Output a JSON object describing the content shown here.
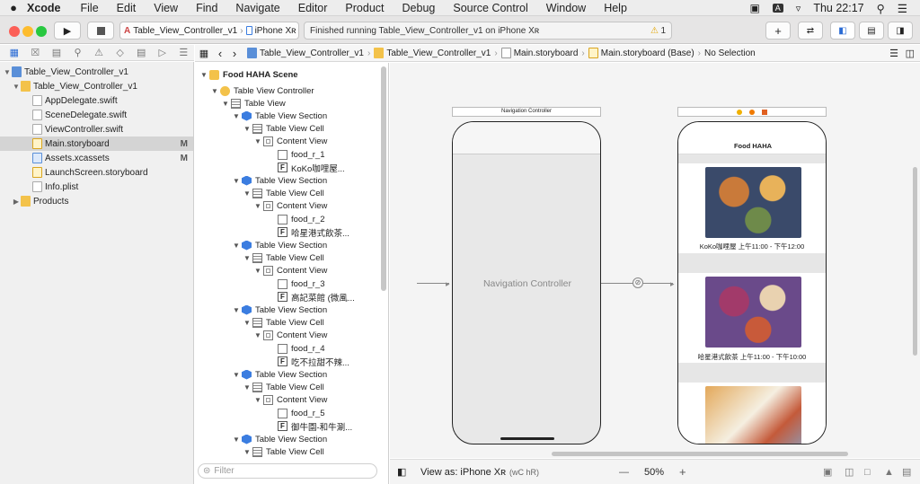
{
  "menubar": {
    "apple": "",
    "app": "Xcode",
    "items": [
      "File",
      "Edit",
      "View",
      "Find",
      "Navigate",
      "Editor",
      "Product",
      "Debug",
      "Source Control",
      "Window",
      "Help"
    ],
    "a_badge": "A",
    "clock": "Thu 22:17"
  },
  "toolbar": {
    "scheme": "Table_View_Controller_v1",
    "device": "iPhone Xʀ",
    "activity": "Finished running Table_View_Controller_v1 on iPhone Xʀ",
    "warning_count": "1"
  },
  "navigator": {
    "rows": [
      {
        "label": "Table_View_Controller_v1",
        "mark": ""
      },
      {
        "label": "Table_View_Controller_v1",
        "mark": ""
      },
      {
        "label": "AppDelegate.swift",
        "mark": ""
      },
      {
        "label": "SceneDelegate.swift",
        "mark": ""
      },
      {
        "label": "ViewController.swift",
        "mark": ""
      },
      {
        "label": "Main.storyboard",
        "mark": "M"
      },
      {
        "label": "Assets.xcassets",
        "mark": "M"
      },
      {
        "label": "LaunchScreen.storyboard",
        "mark": ""
      },
      {
        "label": "Info.plist",
        "mark": ""
      },
      {
        "label": "Products",
        "mark": ""
      }
    ]
  },
  "jumpbar": {
    "crumbs": [
      "Table_View_Controller_v1",
      "Table_View_Controller_v1",
      "Main.storyboard",
      "Main.storyboard (Base)",
      "No Selection"
    ]
  },
  "outline": {
    "scene": "Food HAHA Scene",
    "controller": "Table View Controller",
    "tableview": "Table View",
    "section_label": "Table View Section",
    "cell_label": "Table View Cell",
    "content_label": "Content View",
    "items": [
      {
        "image": "food_r_1",
        "text": "KoKo咖哩屋..."
      },
      {
        "image": "food_r_2",
        "text": "哈星港式飲茶..."
      },
      {
        "image": "food_r_3",
        "text": "高記菜館 (微風..."
      },
      {
        "image": "food_r_4",
        "text": "吃不拉甜不辣..."
      },
      {
        "image": "food_r_5",
        "text": "御牛園-和牛涮..."
      }
    ],
    "filter_placeholder": "Filter"
  },
  "canvas": {
    "nav_header": "Navigation Controller",
    "nav_label": "Navigation Controller",
    "table_title": "Food HAHA",
    "cells": [
      {
        "caption": "KoKo咖哩屋   上午11:00 - 下午12:00",
        "colors": [
          "#c97a3a",
          "#e8b25a",
          "#6e8a4a",
          "#3a4a6a"
        ]
      },
      {
        "caption": "哈星港式飲茶   上午11:00 - 下午10:00",
        "colors": [
          "#a23a6a",
          "#e9d2b0",
          "#c85a3a",
          "#6a4a8a"
        ]
      }
    ]
  },
  "bottombar": {
    "view_as": "View as: iPhone Xʀ",
    "traits": "(wC hR)",
    "zoom": "50%",
    "minus": "—",
    "plus": "+"
  }
}
